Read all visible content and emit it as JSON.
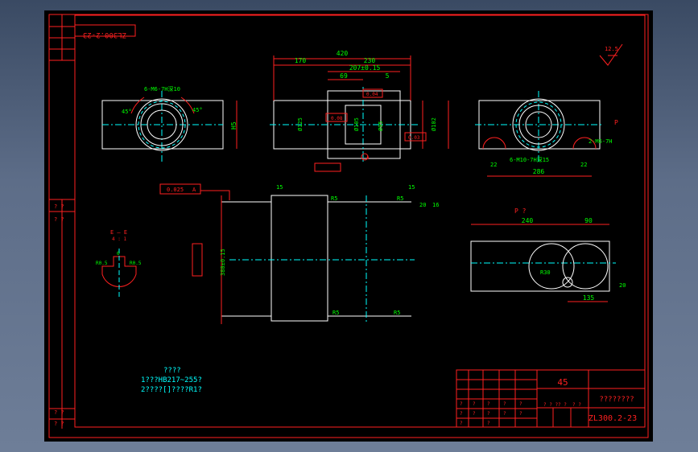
{
  "drawing_number_top": "ZL300.2-23",
  "drawing_number": "ZL300.2-23",
  "material": "45",
  "part_name": "????????",
  "notes_title": "????",
  "notes": [
    "1???HB217~255?",
    "2????[]????R1?"
  ],
  "left_strip_marks": [
    "? ?",
    "? ?",
    "? ?",
    "? ?"
  ],
  "section_label": "E — E",
  "section_scale": "4 : 1",
  "section_dims": {
    "r_left": "R0.5",
    "r_right": "R0.5",
    "top": "6"
  },
  "view_label_p": "P",
  "view_title_p": "P   ?",
  "roughness": "12.5",
  "front_view": {
    "overall_length": "420",
    "left_len": "170",
    "right_len": "230",
    "center_len": "207±0.15",
    "dim_69": "69",
    "dim_5": "5",
    "height_h5": "H5",
    "dia1": "Ø125",
    "dia2": "Ø102",
    "dia3": "Ø95",
    "dia4": "Ø105",
    "tolerance_frame_1": "0.08",
    "tolerance_frame_2": "0.04",
    "tolerance_frame_3": "0.03",
    "datum": "A"
  },
  "left_view": {
    "thread_callout": "6-M6-7H深10",
    "angle_1": "45°",
    "angle_2": "45°"
  },
  "right_view": {
    "thread_callout_1": "6-M10-7H深15",
    "thread_callout_2": "2-M6-7H",
    "dim_286": "286",
    "dim_22a": "22",
    "dim_22b": "22",
    "dim_10": "10"
  },
  "section_view": {
    "dim_15a": "15",
    "dim_15b": "15",
    "r5_tl": "R5",
    "r5_tr": "R5",
    "r5_bl": "R5",
    "r5_br": "R5",
    "dim_20": "20",
    "dim_16": "16",
    "dim_380": "380±0.15",
    "tol_frame": "0.025",
    "tol_datum": "A",
    "tol_side": "0.02"
  },
  "p_view": {
    "dim_240": "240",
    "dim_90": "90",
    "dim_135": "135",
    "dim_20": "20",
    "dim_r30": "R30"
  },
  "title_block": {
    "grid_marks": [
      "?",
      "?",
      "?",
      "?",
      "?",
      "?",
      "?",
      "?",
      "?",
      "?",
      "?",
      "?"
    ],
    "scale_row": [
      "? ? ?",
      "? ?",
      "? ?"
    ]
  }
}
